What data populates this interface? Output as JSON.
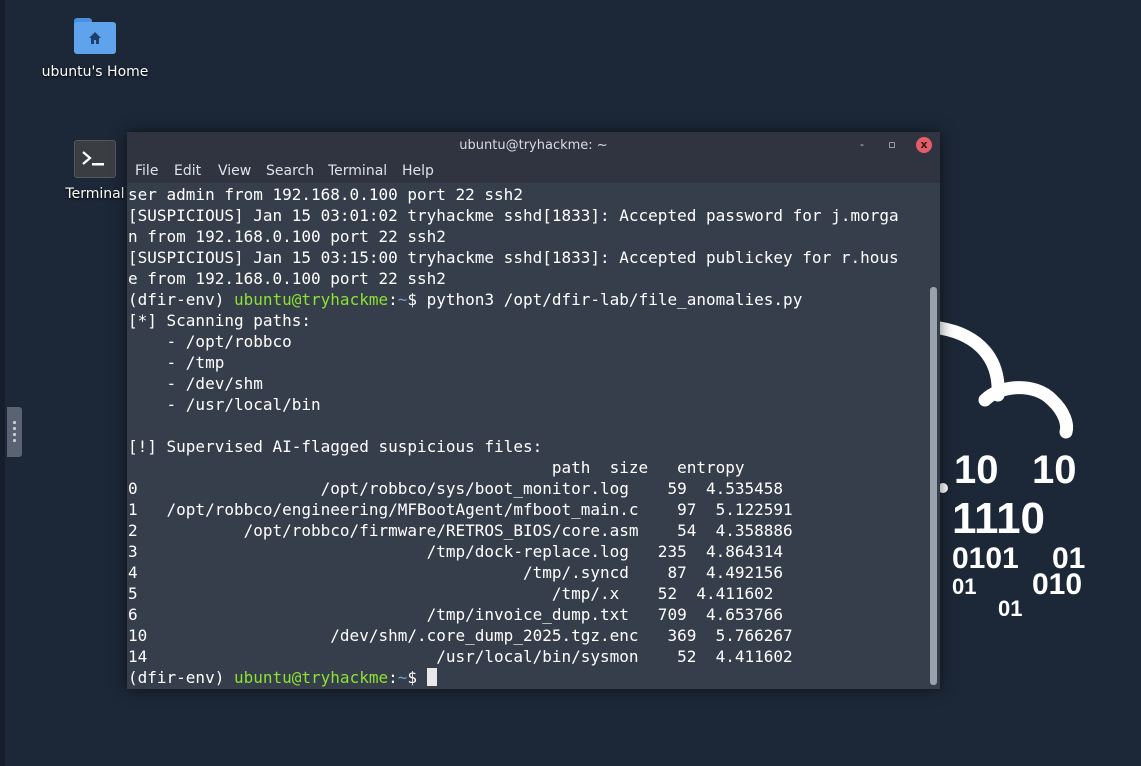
{
  "desktop": {
    "icons": [
      {
        "label": "ubuntu's Home",
        "icon": "home-folder-icon"
      },
      {
        "label": "Terminal",
        "icon": "terminal-icon"
      }
    ]
  },
  "window": {
    "title": "ubuntu@tryhackme: ~",
    "controls": {
      "minimize": "-",
      "maximize": "▫",
      "close": "x"
    },
    "menu": [
      "File",
      "Edit",
      "View",
      "Search",
      "Terminal",
      "Help"
    ]
  },
  "terminal": {
    "log_lines": [
      "ser admin from 192.168.0.100 port 22 ssh2",
      "[SUSPICIOUS] Jan 15 03:01:02 tryhackme sshd[1833]: Accepted password for j.morga",
      "n from 192.168.0.100 port 22 ssh2",
      "[SUSPICIOUS] Jan 15 03:15:00 tryhackme sshd[1833]: Accepted publickey for r.hous",
      "e from 192.168.0.100 port 22 ssh2"
    ],
    "prompt_env": "(dfir-env) ",
    "prompt_user": "ubuntu@tryhackme",
    "prompt_sep": ":",
    "prompt_path": "~",
    "prompt_symbol": "$ ",
    "command": "python3 /opt/dfir-lab/file_anomalies.py",
    "output_lines": [
      "[*] Scanning paths:",
      "    - /opt/robbco",
      "    - /tmp",
      "    - /dev/shm",
      "    - /usr/local/bin",
      "",
      "[!] Supervised AI-flagged suspicious files:",
      "                                            path  size   entropy",
      "0                   /opt/robbco/sys/boot_monitor.log    59  4.535458",
      "1   /opt/robbco/engineering/MFBootAgent/mfboot_main.c    97  5.122591",
      "2           /opt/robbco/firmware/RETROS_BIOS/core.asm    54  4.358886",
      "3                              /tmp/dock-replace.log   235  4.864314",
      "4                                        /tmp/.syncd    87  4.492156",
      "5                                           /tmp/.x    52  4.411602",
      "6                              /tmp/invoice_dump.txt   709  4.653766",
      "10                   /dev/shm/.core_dump_2025.tgz.enc   369  5.766267",
      "14                              /usr/local/bin/sysmon    52  4.411602"
    ]
  },
  "wallpaper": {
    "binary_text": [
      "10",
      "10",
      "1110",
      "0101",
      "01",
      "01",
      "010",
      "01"
    ]
  }
}
